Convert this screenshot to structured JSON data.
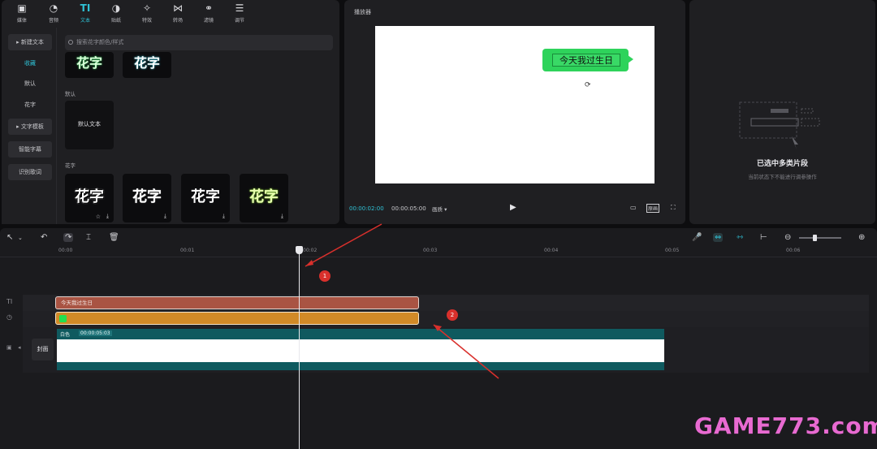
{
  "toolbar": {
    "items": [
      {
        "icon": "media-icon",
        "label": "媒体"
      },
      {
        "icon": "audio-icon",
        "label": "音频"
      },
      {
        "icon": "text-icon",
        "label": "文本"
      },
      {
        "icon": "sticker-icon",
        "label": "贴纸"
      },
      {
        "icon": "effects-icon",
        "label": "特效"
      },
      {
        "icon": "transition-icon",
        "label": "转场"
      },
      {
        "icon": "filter-icon",
        "label": "滤镜"
      },
      {
        "icon": "adjust-icon",
        "label": "调节"
      }
    ],
    "active_index": 2
  },
  "leftnav": {
    "new_text": "新建文本",
    "favorites": "收藏",
    "default": "默认",
    "fancy": "花字",
    "text_template": "文字模板",
    "smart_caption": "智能字幕",
    "lyrics": "识别歌词"
  },
  "media": {
    "search_placeholder": "搜索花字颜色/样式",
    "section_default": "默认",
    "default_text_tile": "默认文本",
    "section_fancy": "花字",
    "tile_glyph": "花字",
    "tile_glyph_partial": "花字"
  },
  "player": {
    "title": "播放器",
    "caption": "今天我过生日",
    "time_current": "00:00:02:00",
    "time_total": "00:00:05:00",
    "ratio_label": "画质 ▾",
    "original_label": "原画"
  },
  "right_panel": {
    "title": "已选中多类片段",
    "subtitle": "当前状态下不能进行调参操作"
  },
  "timeline": {
    "ruler": [
      "00:00",
      "00:01",
      "00:02",
      "00:03",
      "00:04",
      "00:05",
      "00:06"
    ],
    "text_clip_label": "今天我过生日",
    "video_clip_name": "白色",
    "video_clip_duration": "00:00:05:03",
    "cover_label": "封面",
    "markers": [
      "1",
      "2"
    ]
  },
  "watermark": "GAME773.com",
  "colors": {
    "accent": "#2fc2d6",
    "text_clip": "#a95443",
    "anim_clip": "#d18a27",
    "video_clip": "#0f5a5f",
    "bubble": "#2ed35b",
    "marker": "#d9302c"
  }
}
